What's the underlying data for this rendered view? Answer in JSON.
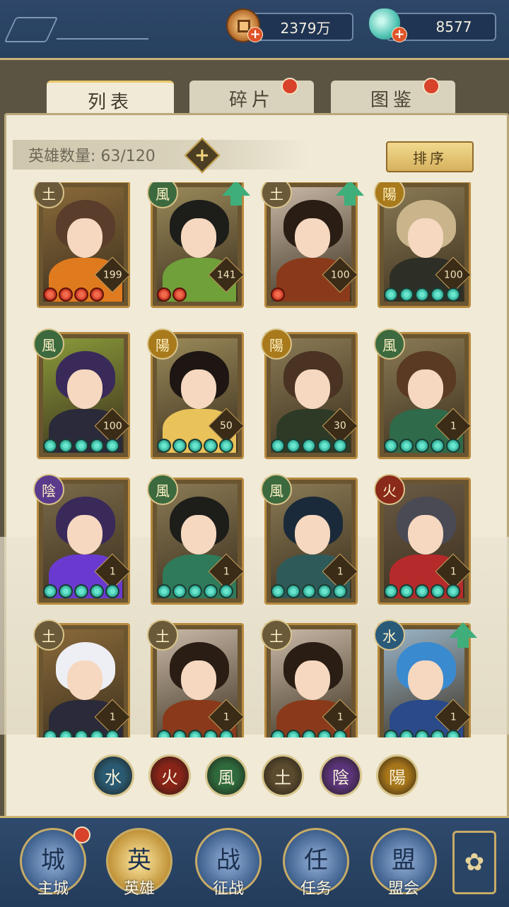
{
  "resources": {
    "coins": "2379万",
    "shells": "8577"
  },
  "tabs": [
    {
      "label": "列表",
      "active": true,
      "badge": false
    },
    {
      "label": "碎片",
      "active": false,
      "badge": true
    },
    {
      "label": "图鉴",
      "active": false,
      "badge": true
    }
  ],
  "hero_count": "英雄数量: 63/120",
  "sort_label": "排序",
  "heroes": [
    {
      "faction": "土",
      "faction_color": "#6b5a3a",
      "level": "199",
      "pips": 4,
      "pip_color": "red",
      "upgrade": false,
      "hair": "#5a3d2a",
      "outfit": "#e07a1f",
      "bg": "#8a6a3a"
    },
    {
      "faction": "風",
      "faction_color": "#3c6a3e",
      "level": "141",
      "pips": 2,
      "pip_color": "red",
      "upgrade": true,
      "hair": "#1d1d1a",
      "outfit": "#6fa03a",
      "bg": "#9a8a5a"
    },
    {
      "faction": "土",
      "faction_color": "#6b5a3a",
      "level": "100",
      "pips": 1,
      "pip_color": "red",
      "upgrade": true,
      "hair": "#2a1d14",
      "outfit": "#8a3a1a",
      "bg": "#c9b9a8"
    },
    {
      "faction": "陽",
      "faction_color": "#a87a1c",
      "level": "100",
      "pips": 5,
      "pip_color": "teal",
      "upgrade": false,
      "hair": "#c9b48c",
      "outfit": "#2d2f26",
      "bg": "#8a7a55"
    },
    {
      "faction": "風",
      "faction_color": "#3c6a3e",
      "level": "100",
      "pips": 5,
      "pip_color": "teal",
      "upgrade": false,
      "hair": "#3a2a5a",
      "outfit": "#2a2a3a",
      "bg": "#8a9a3a"
    },
    {
      "faction": "陽",
      "faction_color": "#a87a1c",
      "level": "50",
      "pips": 5,
      "pip_color": "teal",
      "upgrade": false,
      "hair": "#1d1612",
      "outfit": "#e9c25a",
      "bg": "#9a8a5a"
    },
    {
      "faction": "陽",
      "faction_color": "#a87a1c",
      "level": "30",
      "pips": 5,
      "pip_color": "teal",
      "upgrade": false,
      "hair": "#4a3322",
      "outfit": "#2e3a26",
      "bg": "#8a7a55"
    },
    {
      "faction": "風",
      "faction_color": "#3c6a3e",
      "level": "1",
      "pips": 5,
      "pip_color": "teal",
      "upgrade": false,
      "hair": "#5a3a22",
      "outfit": "#2f6a4a",
      "bg": "#8a7a55"
    },
    {
      "faction": "陰",
      "faction_color": "#5a3a8a",
      "level": "1",
      "pips": 5,
      "pip_color": "teal",
      "upgrade": false,
      "hair": "#3a2a5a",
      "outfit": "#6a3ad0",
      "bg": "#7a6a4a"
    },
    {
      "faction": "風",
      "faction_color": "#3c6a3e",
      "level": "1",
      "pips": 5,
      "pip_color": "teal",
      "upgrade": false,
      "hair": "#1d1d1a",
      "outfit": "#2f7a5a",
      "bg": "#8a7a55"
    },
    {
      "faction": "風",
      "faction_color": "#3c6a3e",
      "level": "1",
      "pips": 5,
      "pip_color": "teal",
      "upgrade": false,
      "hair": "#1a2a3a",
      "outfit": "#2f5a5a",
      "bg": "#8a7a55"
    },
    {
      "faction": "火",
      "faction_color": "#8a2a1a",
      "level": "1",
      "pips": 5,
      "pip_color": "teal",
      "upgrade": false,
      "hair": "#4a4a55",
      "outfit": "#b52a2a",
      "bg": "#6a5a45"
    },
    {
      "faction": "土",
      "faction_color": "#6b5a3a",
      "level": "1",
      "pips": 5,
      "pip_color": "teal",
      "upgrade": false,
      "hair": "#eeeef5",
      "outfit": "#2a2a3a",
      "bg": "#8a6a3a"
    },
    {
      "faction": "土",
      "faction_color": "#6b5a3a",
      "level": "1",
      "pips": 5,
      "pip_color": "teal",
      "upgrade": false,
      "hair": "#2a1d14",
      "outfit": "#8a3a1a",
      "bg": "#c9b9a8"
    },
    {
      "faction": "土",
      "faction_color": "#6b5a3a",
      "level": "1",
      "pips": 5,
      "pip_color": "teal",
      "upgrade": false,
      "hair": "#2a1d14",
      "outfit": "#8a3a1a",
      "bg": "#c9b9a8"
    },
    {
      "faction": "水",
      "faction_color": "#2a5a7a",
      "level": "1",
      "pips": 5,
      "pip_color": "teal",
      "upgrade": true,
      "hair": "#3a8ad0",
      "outfit": "#2a4a8a",
      "bg": "#9ab5c9"
    }
  ],
  "faction_filters": [
    {
      "label": "水",
      "color": "#2a5a72"
    },
    {
      "label": "火",
      "color": "#8a2418"
    },
    {
      "label": "風",
      "color": "#2e6a3c"
    },
    {
      "label": "土",
      "color": "#5a4a2e"
    },
    {
      "label": "陰",
      "color": "#5a3478"
    },
    {
      "label": "陽",
      "color": "#a8761a"
    }
  ],
  "nav": [
    {
      "label": "主城",
      "badge": true,
      "active": false,
      "glyph": "城"
    },
    {
      "label": "英雄",
      "badge": false,
      "active": true,
      "glyph": "英"
    },
    {
      "label": "征战",
      "badge": false,
      "active": false,
      "glyph": "战"
    },
    {
      "label": "任务",
      "badge": false,
      "active": false,
      "glyph": "任"
    },
    {
      "label": "盟会",
      "badge": false,
      "active": false,
      "glyph": "盟"
    }
  ]
}
